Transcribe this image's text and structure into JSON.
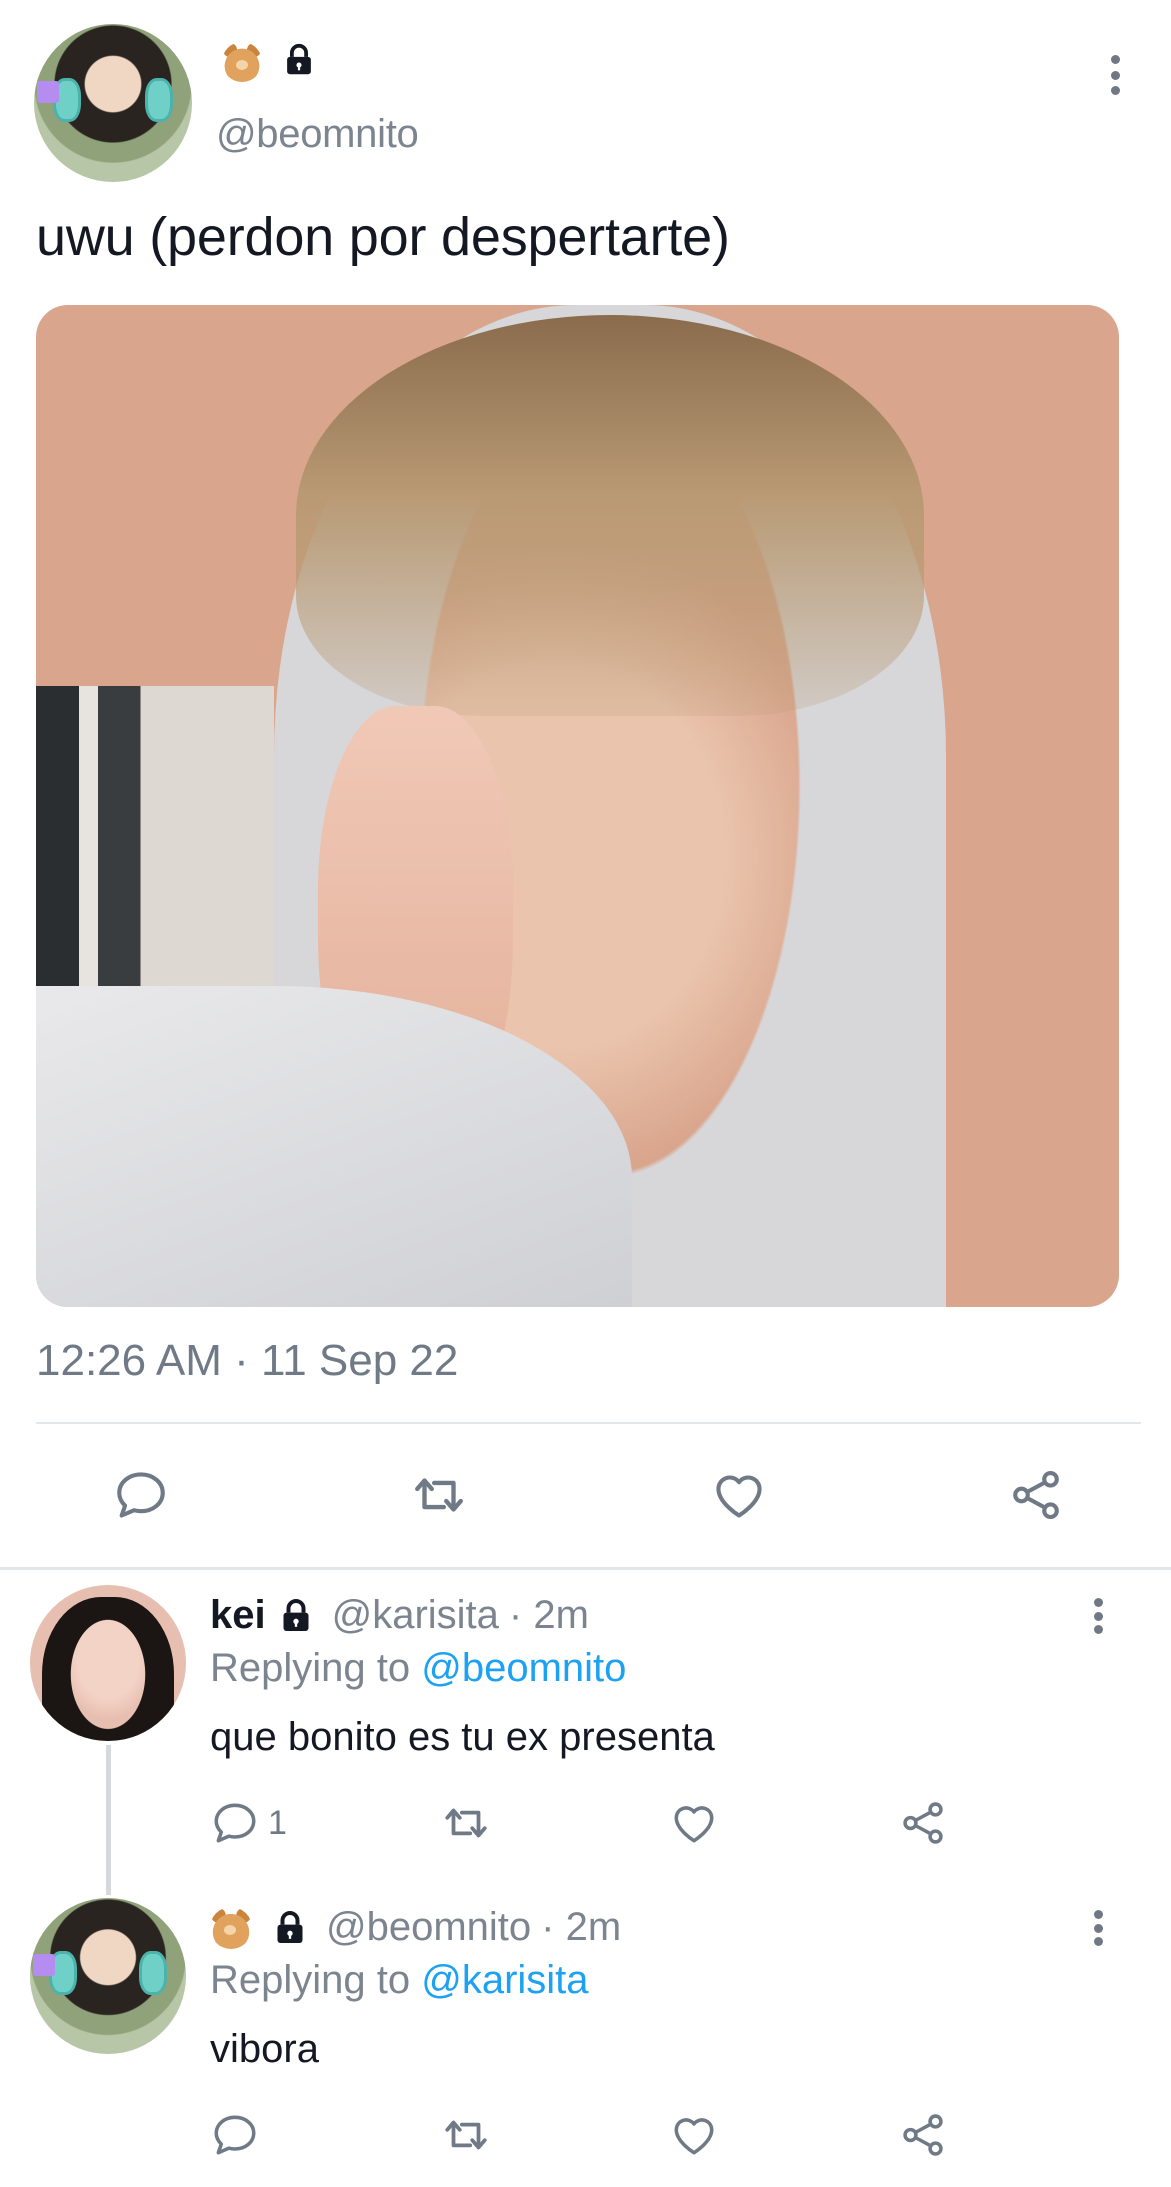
{
  "main_tweet": {
    "handle": "@beomnito",
    "text": "uwu (perdon por despertarte)",
    "timestamp": "12:26 AM · 11 Sep 22",
    "icons": [
      "teddy-bear-emoji",
      "lock-icon",
      "more-icon"
    ],
    "actions": [
      "reply-icon",
      "retweet-icon",
      "like-icon",
      "share-icon"
    ]
  },
  "replies": [
    {
      "name": "kei",
      "handle": "@karisita",
      "time": "· 2m",
      "replying_prefix": "Replying to ",
      "replying_to": "@beomnito",
      "text": "que bonito es tu ex presenta",
      "reply_count": "1"
    },
    {
      "name": "",
      "handle": "@beomnito",
      "time": "· 2m",
      "replying_prefix": "Replying to ",
      "replying_to": "@karisita",
      "text": "vibora",
      "reply_count": ""
    }
  ],
  "colors": {
    "accent": "#1da1f2",
    "text": "#141823",
    "muted": "#7c858f",
    "divider": "#e3e6ea",
    "icon": "#6f7a86"
  }
}
